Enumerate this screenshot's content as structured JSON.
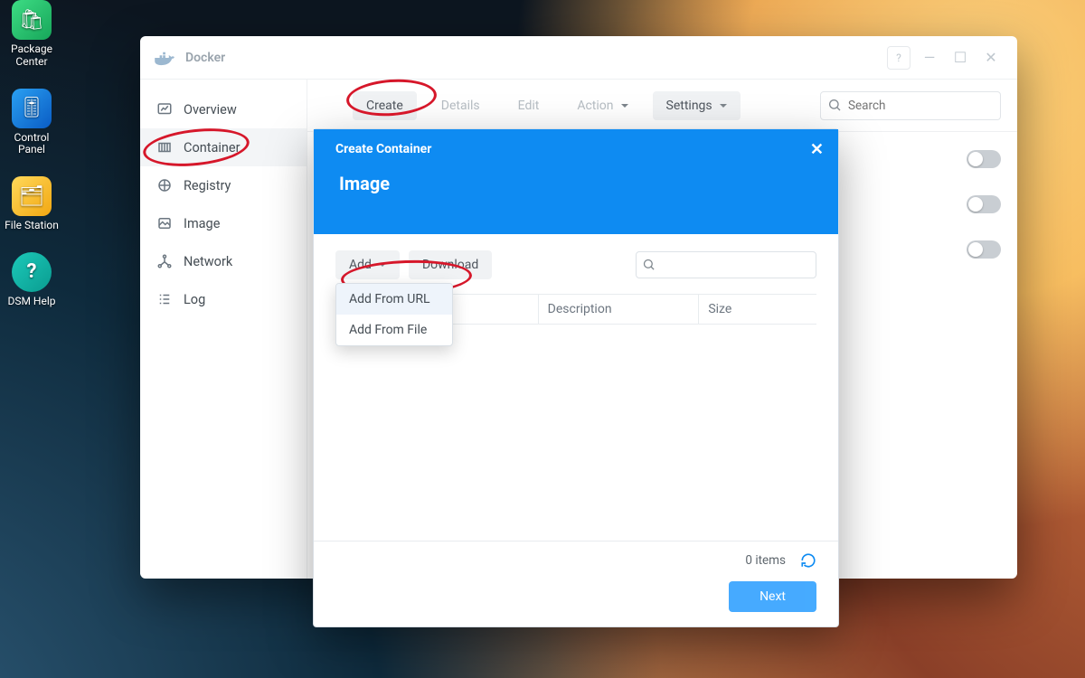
{
  "desktop": {
    "icons": {
      "package_center": "Package\nCenter",
      "control_panel": "Control Panel",
      "file_station": "File Station",
      "dsm_help": "DSM Help"
    }
  },
  "docker": {
    "title": "Docker",
    "sidebar": {
      "overview": "Overview",
      "container": "Container",
      "registry": "Registry",
      "image": "Image",
      "network": "Network",
      "log": "Log"
    },
    "toolbar": {
      "create": "Create",
      "details": "Details",
      "edit": "Edit",
      "action": "Action",
      "settings": "Settings",
      "search_placeholder": "Search"
    }
  },
  "dialog": {
    "title": "Create Container",
    "subtitle": "Image",
    "add": "Add",
    "download": "Download",
    "menu": {
      "url": "Add From URL",
      "file": "Add From File"
    },
    "col_desc": "Description",
    "col_size": "Size",
    "items": "0 items",
    "next": "Next"
  }
}
